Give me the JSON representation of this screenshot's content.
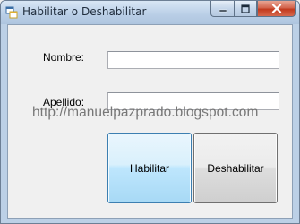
{
  "window": {
    "title": "Habilitar o Deshabilitar",
    "icon": "windows-forms-app-icon"
  },
  "form": {
    "nombre_label": "Nombre:",
    "nombre_value": "",
    "apellido_label": "Apellido:",
    "apellido_value": ""
  },
  "buttons": {
    "habilitar_label": "Habilitar",
    "deshabilitar_label": "Deshabilitar"
  },
  "watermark": "http://manuelpazprado.blogspot.com",
  "colors": {
    "close_button": "#c23a1e",
    "focused_button": "#a7d9f5",
    "window_frame": "#bcd0e6"
  }
}
